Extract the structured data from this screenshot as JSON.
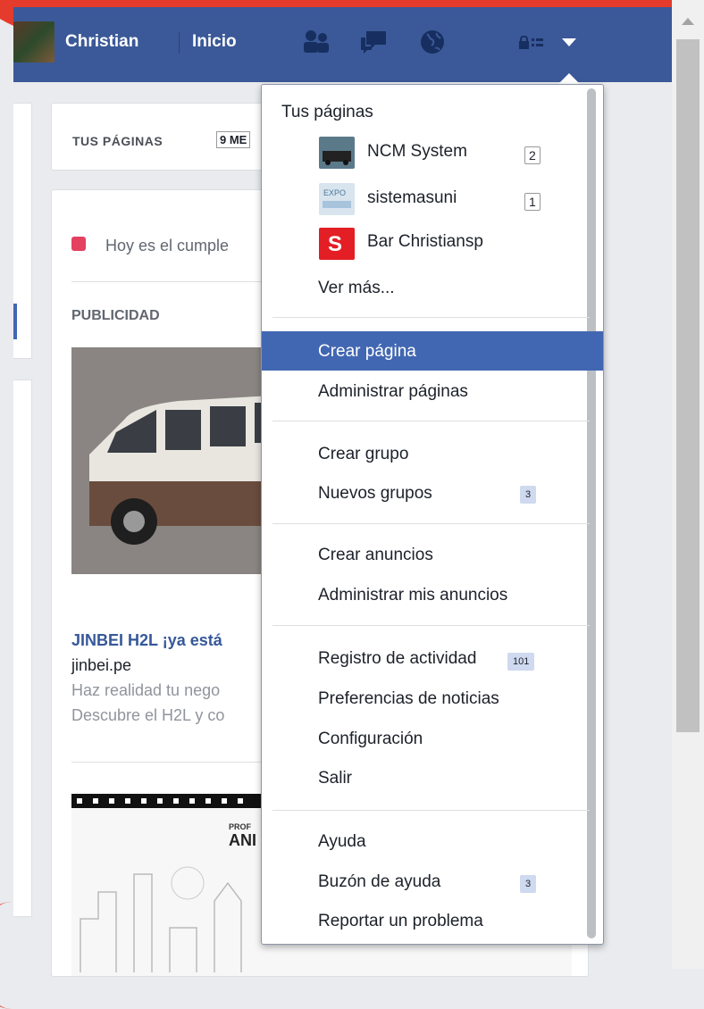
{
  "topbar": {
    "user_name": "Christian",
    "home_label": "Inicio",
    "icons": [
      "friends-icon",
      "messages-icon",
      "notifications-globe-icon",
      "privacy-lock-icon",
      "account-menu-caret-icon"
    ],
    "bg_color": "#3b5998"
  },
  "left_card": {
    "your_pages_label": "TUS PÁGINAS",
    "month_label": "9 ME"
  },
  "feed": {
    "birthday_text": "Hoy es el cumple",
    "ads_label": "PUBLICIDAD",
    "ad_title": "JINBEI H2L ¡ya está",
    "ad_domain": "jinbei.pe",
    "ad_desc_line1": "Haz realidad tu nego",
    "ad_desc_line2": "Descubre el H2L y co",
    "ad2_text_small": "PROF",
    "ad2_text_big": "ANI"
  },
  "dropdown": {
    "your_pages_header": "Tus páginas",
    "pages": [
      {
        "name": "NCM System",
        "count": "2"
      },
      {
        "name": "sistemasuni",
        "count": "1"
      },
      {
        "name": "Bar Christiansp",
        "count": ""
      }
    ],
    "see_more": "Ver más...",
    "create_page": "Crear página",
    "manage_pages": "Administrar páginas",
    "create_group": "Crear grupo",
    "new_groups": "Nuevos grupos",
    "new_groups_count": "3",
    "create_ads": "Crear anuncios",
    "manage_ads": "Administrar mis anuncios",
    "activity_log": "Registro de actividad",
    "activity_log_count": "101",
    "news_feed_prefs": "Preferencias de noticias",
    "settings": "Configuración",
    "logout": "Salir",
    "help": "Ayuda",
    "support_inbox": "Buzón de ayuda",
    "support_inbox_count": "3",
    "report_problem": "Reportar un problema",
    "highlight_color": "#4267b2"
  }
}
